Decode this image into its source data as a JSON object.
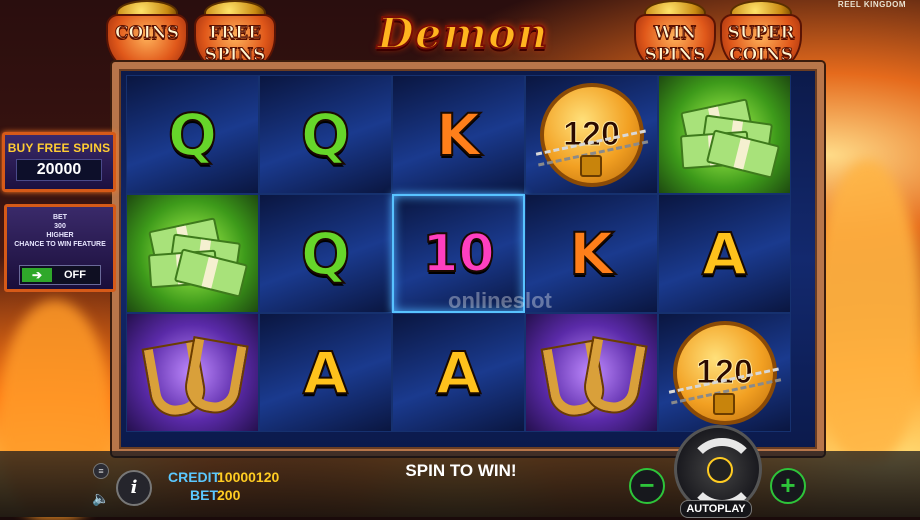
{
  "brand": "REEL KINGDOM",
  "game_title": "Demon Pots",
  "pots": [
    {
      "label_line1": "COINS",
      "label_line2": ""
    },
    {
      "label_line1": "FREE",
      "label_line2": "SPINS"
    },
    {
      "label_line1": "WIN",
      "label_line2": "SPINS"
    },
    {
      "label_line1": "SUPER",
      "label_line2": "COINS"
    }
  ],
  "buy_free_spins": {
    "label": "BUY FREE SPINS",
    "price": "20000"
  },
  "ante_bet": {
    "line1": "BET",
    "line2": "300",
    "line3": "HIGHER",
    "line4": "CHANCE TO WIN FEATURE",
    "state": "OFF"
  },
  "reels": {
    "rows": [
      [
        {
          "symbol": "Q",
          "kind": "letter"
        },
        {
          "symbol": "Q",
          "kind": "letter"
        },
        {
          "symbol": "K",
          "kind": "letter"
        },
        {
          "symbol": "coin",
          "kind": "coin",
          "value": "120"
        },
        {
          "symbol": "cash",
          "kind": "cash"
        }
      ],
      [
        {
          "symbol": "cash",
          "kind": "cash"
        },
        {
          "symbol": "Q",
          "kind": "letter"
        },
        {
          "symbol": "10",
          "kind": "letter",
          "highlighted": true
        },
        {
          "symbol": "K",
          "kind": "letter"
        },
        {
          "symbol": "A",
          "kind": "letter"
        }
      ],
      [
        {
          "symbol": "horseshoe",
          "kind": "horseshoe"
        },
        {
          "symbol": "A",
          "kind": "letter"
        },
        {
          "symbol": "A",
          "kind": "letter"
        },
        {
          "symbol": "horseshoe",
          "kind": "horseshoe"
        },
        {
          "symbol": "coin",
          "kind": "coin",
          "value": "120"
        }
      ]
    ]
  },
  "watermark": "onlineslot",
  "bottom_bar": {
    "credit_label": "CREDIT",
    "credit_value": "10000120",
    "bet_label": "BET",
    "bet_value": "200",
    "message": "SPIN TO WIN!",
    "autoplay_label": "AUTOPLAY",
    "minus_label": "−",
    "plus_label": "+",
    "info_label": "i"
  },
  "colors": {
    "frame": "#b8764a",
    "credit_label": "#5bc8ff",
    "credit_value": "#ffcc22",
    "stake_buttons": "#2ec43a"
  }
}
